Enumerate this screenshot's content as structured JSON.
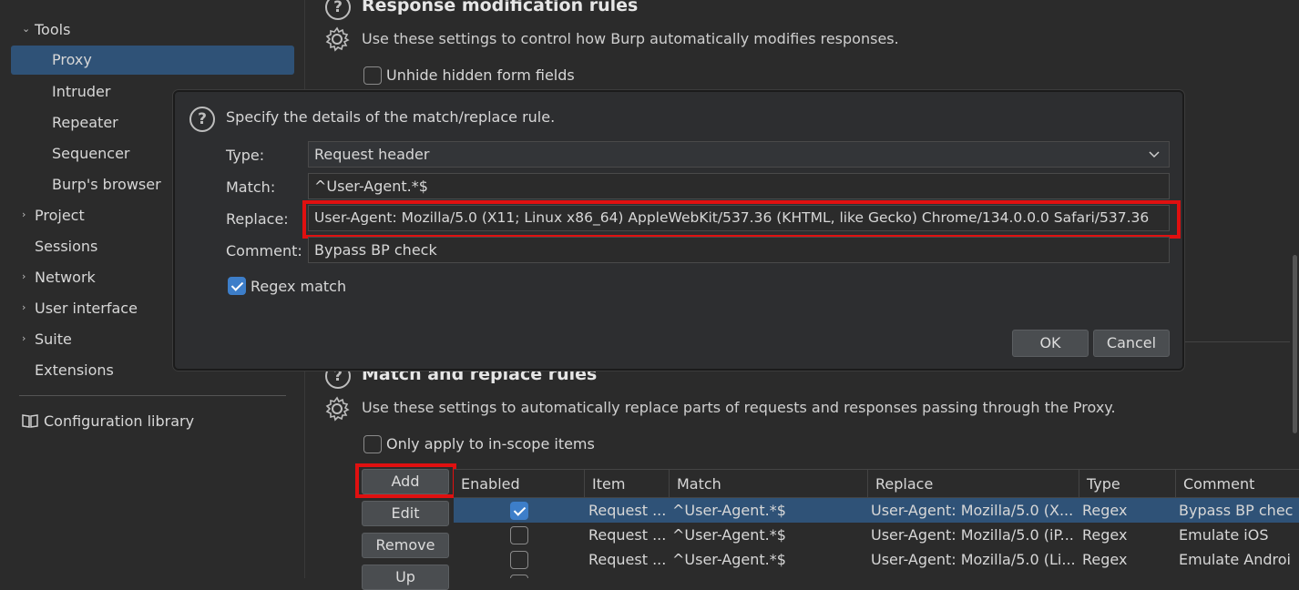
{
  "sidebar": {
    "tools_label": "Tools",
    "items": [
      {
        "label": "Proxy"
      },
      {
        "label": "Intruder"
      },
      {
        "label": "Repeater"
      },
      {
        "label": "Sequencer"
      },
      {
        "label": "Burp's browser"
      }
    ],
    "sections": [
      {
        "label": "Project"
      },
      {
        "label": "Sessions"
      },
      {
        "label": "Network"
      },
      {
        "label": "User interface"
      },
      {
        "label": "Suite"
      },
      {
        "label": "Extensions"
      }
    ],
    "config_library": "Configuration library"
  },
  "response_rules": {
    "title": "Response modification rules",
    "description": "Use these settings to control how Burp automatically modifies responses.",
    "unhide_label": "Unhide hidden form fields"
  },
  "match_replace": {
    "title": "Match and replace rules",
    "description": "Use these settings to automatically replace parts of requests and responses passing through the Proxy.",
    "scope_label": "Only apply to in-scope items",
    "buttons": {
      "add": "Add",
      "edit": "Edit",
      "remove": "Remove",
      "up": "Up"
    },
    "columns": [
      "Enabled",
      "Item",
      "Match",
      "Replace",
      "Type",
      "Comment"
    ],
    "rows": [
      {
        "enabled": true,
        "item": "Request ...",
        "match": "^User-Agent.*$",
        "replace": "User-Agent: Mozilla/5.0 (X...",
        "type": "Regex",
        "comment": "Bypass BP chec"
      },
      {
        "enabled": false,
        "item": "Request ...",
        "match": "^User-Agent.*$",
        "replace": "User-Agent: Mozilla/5.0 (iP...",
        "type": "Regex",
        "comment": "Emulate iOS"
      },
      {
        "enabled": false,
        "item": "Request ...",
        "match": "^User-Agent.*$",
        "replace": "User-Agent: Mozilla/5.0 (Li...",
        "type": "Regex",
        "comment": "Emulate Androi"
      }
    ]
  },
  "dialog": {
    "heading": "Specify the details of the match/replace rule.",
    "type_label": "Type:",
    "type_value": "Request header",
    "match_label": "Match:",
    "match_value": "^User-Agent.*$",
    "replace_label": "Replace:",
    "replace_value": "User-Agent: Mozilla/5.0 (X11; Linux x86_64) AppleWebKit/537.36 (KHTML, like Gecko) Chrome/134.0.0.0 Safari/537.36",
    "comment_label": "Comment:",
    "comment_value": "Bypass BP check",
    "regex_label": "Regex match",
    "ok": "OK",
    "cancel": "Cancel"
  },
  "colors": {
    "selection": "#2f5277",
    "highlight": "#e01010",
    "checkbox": "#3d7ec9"
  }
}
